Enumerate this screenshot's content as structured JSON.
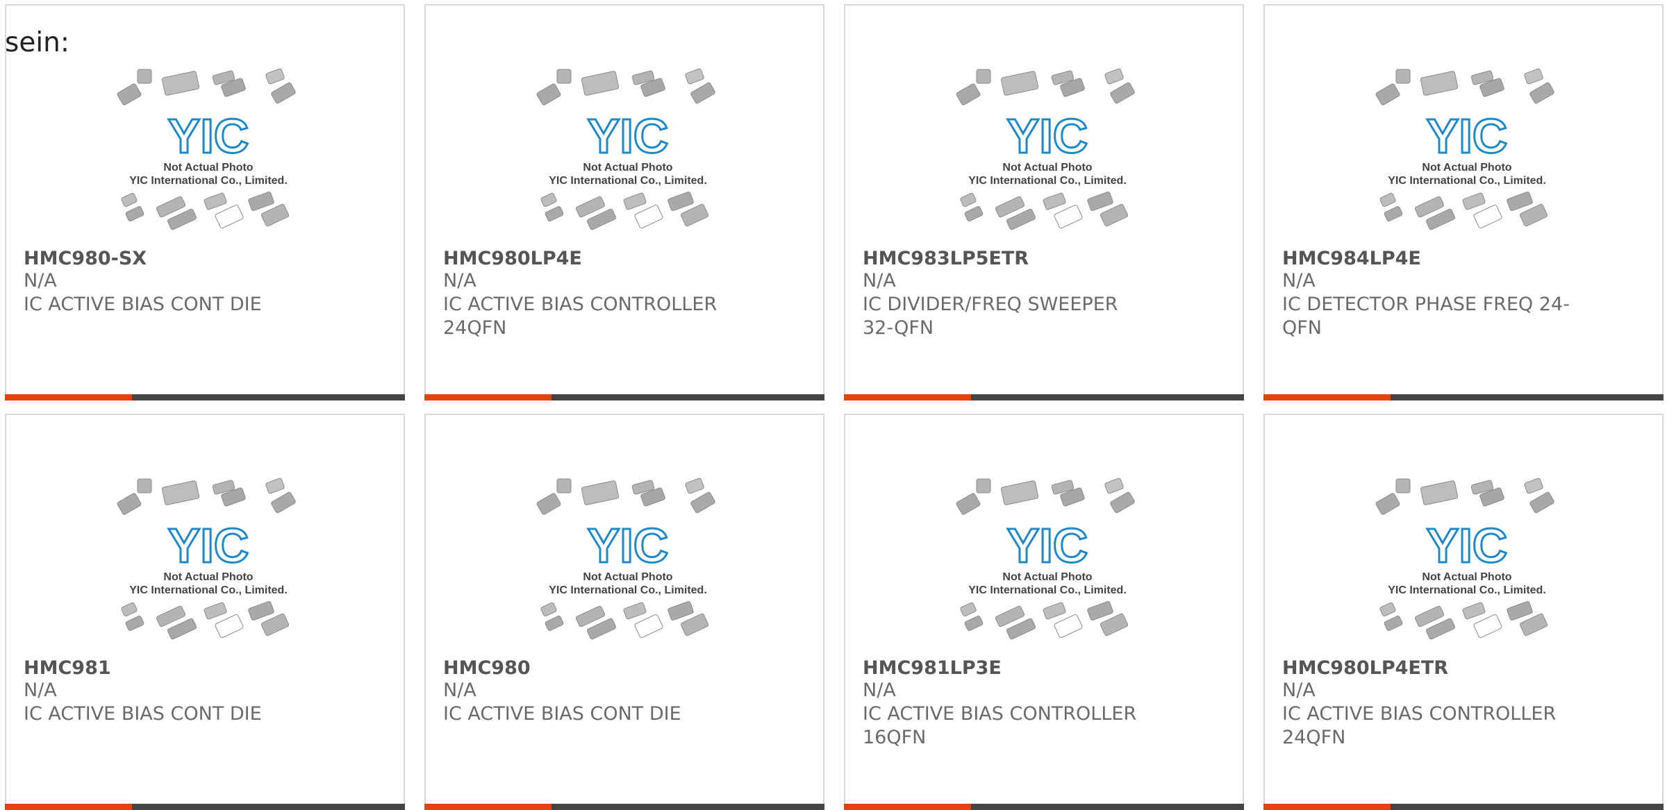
{
  "lead_text": "sein:",
  "placeholder": {
    "line1": "Not Actual Photo",
    "line2": "YIC International Co., Limited.",
    "logo_text": "YIC"
  },
  "colors": {
    "accent": "#e8400c",
    "bar": "#444444",
    "logo_blue": "#1e88c8"
  },
  "products": [
    {
      "part_number": "HMC980-SX",
      "manufacturer": "N/A",
      "description": "IC ACTIVE BIAS CONT DIE"
    },
    {
      "part_number": "HMC980LP4E",
      "manufacturer": "N/A",
      "description": "IC ACTIVE BIAS CONTROLLER 24QFN"
    },
    {
      "part_number": "HMC983LP5ETR",
      "manufacturer": "N/A",
      "description": "IC DIVIDER/FREQ SWEEPER 32-QFN"
    },
    {
      "part_number": "HMC984LP4E",
      "manufacturer": "N/A",
      "description": "IC DETECTOR PHASE FREQ 24-QFN"
    },
    {
      "part_number": "HMC981",
      "manufacturer": "N/A",
      "description": "IC ACTIVE BIAS CONT DIE"
    },
    {
      "part_number": "HMC980",
      "manufacturer": "N/A",
      "description": "IC ACTIVE BIAS CONT DIE"
    },
    {
      "part_number": "HMC981LP3E",
      "manufacturer": "N/A",
      "description": "IC ACTIVE BIAS CONTROLLER 16QFN"
    },
    {
      "part_number": "HMC980LP4ETR",
      "manufacturer": "N/A",
      "description": "IC ACTIVE BIAS CONTROLLER 24QFN"
    }
  ]
}
